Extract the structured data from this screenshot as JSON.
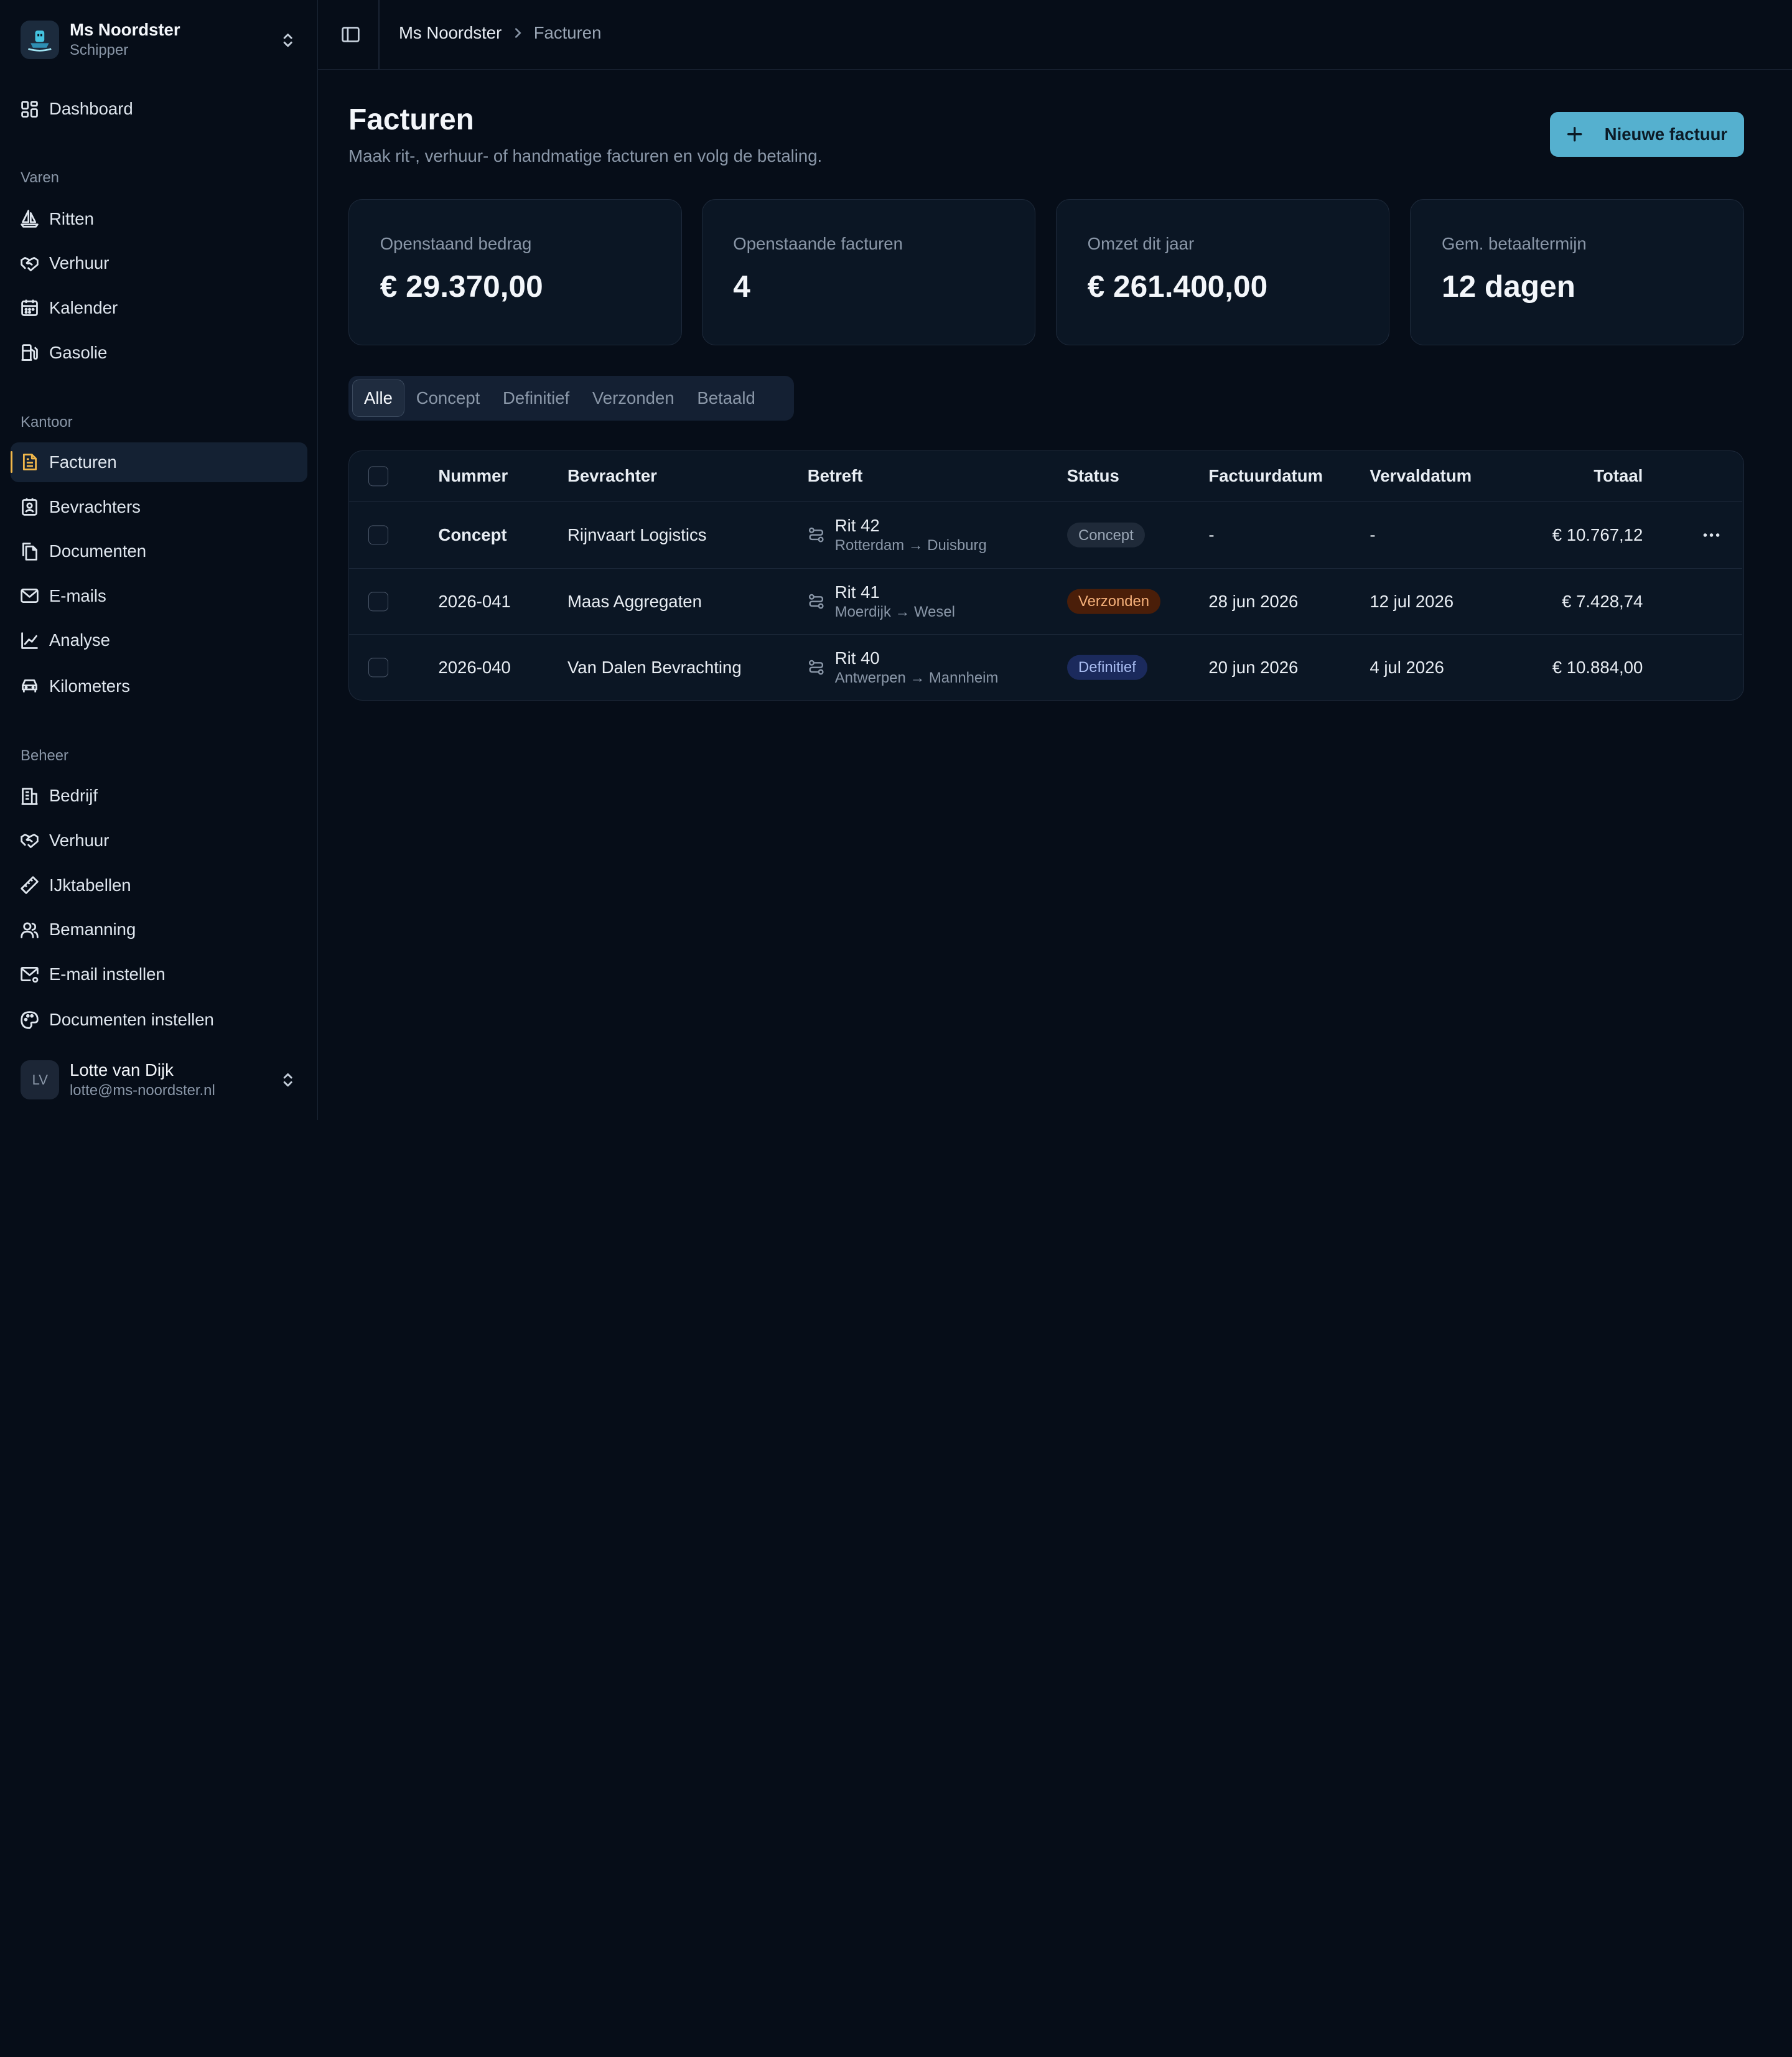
{
  "workspace": {
    "name": "Ms Noordster",
    "role": "Schipper"
  },
  "nav": {
    "dashboard": "Dashboard",
    "section_varen": "Varen",
    "varen": [
      "Ritten",
      "Verhuur",
      "Kalender",
      "Gasolie"
    ],
    "section_kantoor": "Kantoor",
    "kantoor": [
      "Facturen",
      "Bevrachters",
      "Documenten",
      "E-mails",
      "Analyse",
      "Kilometers"
    ],
    "section_beheer": "Beheer",
    "beheer": [
      "Bedrijf",
      "Verhuur",
      "IJktabellen",
      "Bemanning",
      "E-mail instellen",
      "Documenten instellen"
    ],
    "active": "Facturen"
  },
  "user": {
    "initials": "LV",
    "name": "Lotte van Dijk",
    "email": "lotte@ms-noordster.nl"
  },
  "breadcrumb": {
    "root": "Ms Noordster",
    "current": "Facturen"
  },
  "page": {
    "title": "Facturen",
    "subtitle": "Maak rit-, verhuur- of handmatige facturen en volg de betaling.",
    "new_button": "Nieuwe factuur"
  },
  "stats": [
    {
      "label": "Openstaand bedrag",
      "value": "€ 29.370,00"
    },
    {
      "label": "Openstaande facturen",
      "value": "4"
    },
    {
      "label": "Omzet dit jaar",
      "value": "€ 261.400,00"
    },
    {
      "label": "Gem. betaaltermijn",
      "value": "12 dagen"
    }
  ],
  "filters": [
    "Alle",
    "Concept",
    "Definitief",
    "Verzonden",
    "Betaald"
  ],
  "active_filter": "Alle",
  "table": {
    "columns": [
      "Nummer",
      "Bevrachter",
      "Betreft",
      "Status",
      "Factuurdatum",
      "Vervaldatum",
      "Totaal"
    ],
    "rows": [
      {
        "nummer": "Concept",
        "bevrachter": "Rijnvaart Logistics",
        "rit": "Rit 42",
        "route": "Rotterdam → Duisburg",
        "status": "Concept",
        "factuurdatum": "-",
        "vervaldatum": "-",
        "totaal": "€ 10.767,12"
      },
      {
        "nummer": "2026-041",
        "bevrachter": "Maas Aggregaten",
        "rit": "Rit 41",
        "route": "Moerdijk → Wesel",
        "status": "Verzonden",
        "factuurdatum": "28 jun 2026",
        "vervaldatum": "12 jul 2026",
        "totaal": "€ 7.428,74"
      },
      {
        "nummer": "2026-040",
        "bevrachter": "Van Dalen Bevrachting",
        "rit": "Rit 40",
        "route": "Antwerpen → Mannheim",
        "status": "Definitief",
        "factuurdatum": "20 jun 2026",
        "vervaldatum": "4 jul 2026",
        "totaal": "€ 10.884,00"
      }
    ]
  },
  "colors": {
    "background": "#060d18",
    "card": "#0b1624",
    "accent": "#55b0cf",
    "active_marker": "#f2b84b",
    "badge_verzonden": "#4a1e09",
    "badge_definitief": "#1b2a5c"
  }
}
